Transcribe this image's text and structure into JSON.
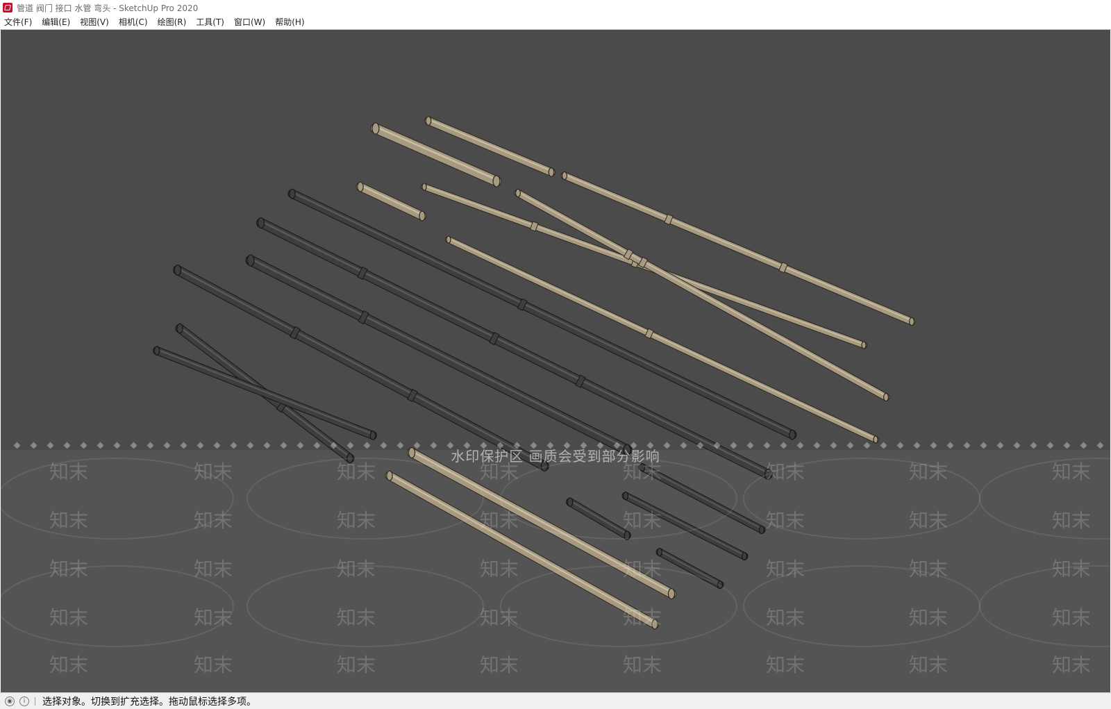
{
  "window": {
    "title": "管道 阀门 接口 水管 弯头 - SketchUp Pro 2020",
    "icon": "sketchup-app-icon"
  },
  "menu": [
    {
      "label": "文件(F)"
    },
    {
      "label": "编辑(E)"
    },
    {
      "label": "视图(V)"
    },
    {
      "label": "相机(C)"
    },
    {
      "label": "绘图(R)"
    },
    {
      "label": "工具(T)"
    },
    {
      "label": "窗口(W)"
    },
    {
      "label": "帮助(H)"
    }
  ],
  "viewport": {
    "background": "#4b4b4b",
    "watermark_banner": "水印保护区  画质会受到部分影响",
    "watermark_tile": "知末"
  },
  "colors": {
    "tan_pipe": "#a89a80",
    "tan_pipe_edge": "#2a2620",
    "dark_pipe": "#3e3e3e",
    "dark_pipe_edge": "#161616",
    "accent_red": "#c8102e"
  },
  "status": {
    "icons": [
      "geo-location-icon",
      "info-icon"
    ],
    "text": "选择对象。切换到扩充选择。拖动鼠标选择多项。"
  }
}
